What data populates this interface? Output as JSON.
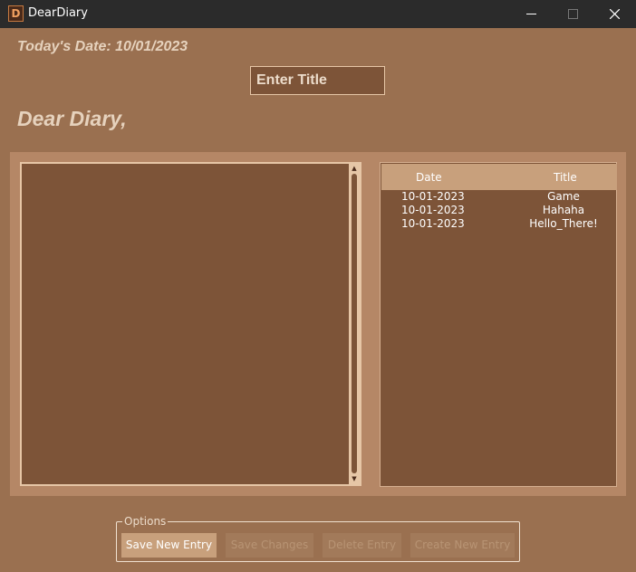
{
  "window": {
    "icon_text": "D",
    "title": "DearDiary",
    "minimize_glyph": "—",
    "maximize_glyph": "☐",
    "close_glyph": "✕"
  },
  "header": {
    "date_label": "Today's Date: 10/01/2023",
    "title_placeholder": "Enter Title",
    "greeting": "Dear Diary,"
  },
  "editor": {
    "content": "",
    "scroll_up_glyph": "▲",
    "scroll_down_glyph": "▼"
  },
  "entries": {
    "columns": [
      "Date",
      "Title"
    ],
    "rows": [
      {
        "date": "10-01-2023",
        "title": "Game"
      },
      {
        "date": "10-01-2023",
        "title": "Hahaha"
      },
      {
        "date": "10-01-2023",
        "title": "Hello_There!"
      }
    ]
  },
  "options": {
    "label": "Options",
    "buttons": [
      {
        "label": "Save New Entry",
        "state": "enabled"
      },
      {
        "label": "Save Changes",
        "state": "disabled"
      },
      {
        "label": "Delete Entry",
        "state": "disabled"
      },
      {
        "label": "Create New Entry",
        "state": "disabled"
      }
    ]
  },
  "colors": {
    "background": "#9a7050",
    "panel": "#b58766",
    "field": "#7d5438",
    "accent": "#c8a07c",
    "text_light": "#e6d2bd"
  }
}
